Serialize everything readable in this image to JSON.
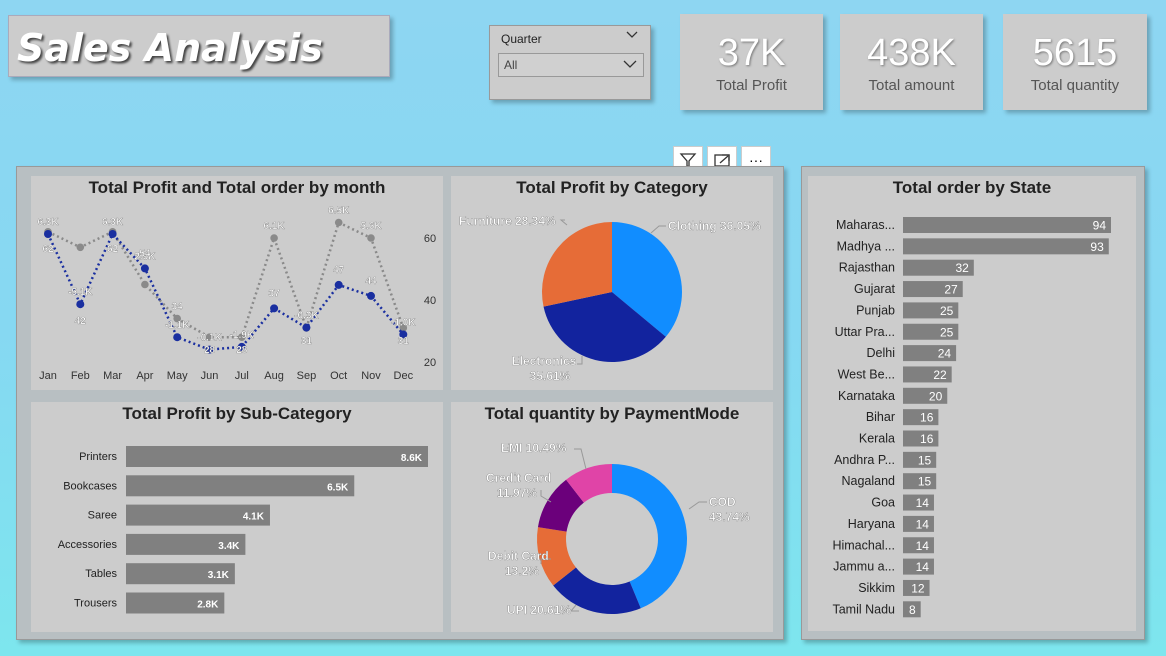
{
  "title": "Sales Analysis",
  "slicer": {
    "label": "Quarter",
    "value": "All"
  },
  "kpis": {
    "profit": {
      "value": "37K",
      "label": "Total Profit"
    },
    "amount": {
      "value": "438K",
      "label": "Total amount"
    },
    "quantity": {
      "value": "5615",
      "label": "Total quantity"
    }
  },
  "toolbar": {
    "more_label": "···"
  },
  "colors": {
    "profit": "#1a2fa0",
    "orders": "#8a8a8a",
    "bar": "#808080",
    "accent_blue": "#118dff",
    "dark_blue": "#12239e",
    "orange": "#e66c37",
    "purple": "#6b007b",
    "pink": "#e044a7"
  },
  "chart_data": [
    {
      "type": "line",
      "title": "Total Profit and Total order by month",
      "categories": [
        "Jan",
        "Feb",
        "Mar",
        "Apr",
        "May",
        "Jun",
        "Jul",
        "Aug",
        "Sep",
        "Oct",
        "Nov",
        "Dec"
      ],
      "series": [
        {
          "axis": "left",
          "values": [
            6300,
            1200,
            6300,
            3800,
            -1200,
            -2100,
            -1900,
            900,
            -500,
            2600,
            1800,
            -1000
          ],
          "labels": [
            "6.3K",
            "-5.1K",
            "6.3K",
            "2.9K",
            "-1.1K",
            "-0.1K",
            "-1.9K",
            "",
            "-0.3K",
            "",
            "",
            "-1.0K"
          ]
        },
        {
          "axis": "right",
          "values": [
            62,
            57,
            62,
            45,
            34,
            28,
            28,
            60,
            31,
            65,
            60,
            31
          ],
          "labels": [
            "62",
            "42",
            "62",
            "54",
            "34",
            "28",
            "28",
            "37",
            "31",
            "47",
            "44",
            "31"
          ]
        }
      ],
      "top_labels": [
        "",
        "",
        "",
        "",
        "",
        "",
        "",
        "6.1K",
        "",
        "6.5K",
        "5.6K",
        ""
      ],
      "right_ticks": [
        "60",
        "40",
        "20"
      ]
    },
    {
      "type": "pie",
      "title": "Total Profit by Category",
      "slices": [
        {
          "label": "Clothing 36.05%",
          "value": 36.05
        },
        {
          "label": "Electronics 35.61%",
          "value": 35.61
        },
        {
          "label": "Furniture 28.34%",
          "value": 28.34
        }
      ]
    },
    {
      "type": "bar",
      "title": "Total Profit by Sub-Category",
      "categories": [
        "Printers",
        "Bookcases",
        "Saree",
        "Accessories",
        "Tables",
        "Trousers"
      ],
      "values": [
        8.6,
        6.5,
        4.1,
        3.4,
        3.1,
        2.8
      ],
      "labels": [
        "8.6K",
        "6.5K",
        "4.1K",
        "3.4K",
        "3.1K",
        "2.8K"
      ]
    },
    {
      "type": "pie",
      "title": "Total quantity by PaymentMode",
      "slices": [
        {
          "label": "COD 43.74%",
          "value": 43.74
        },
        {
          "label": "UPI 20.61%",
          "value": 20.61
        },
        {
          "label": "Debit Card 13.2%",
          "value": 13.2
        },
        {
          "label": "Credit Card 11.97%",
          "value": 11.97
        },
        {
          "label": "EMI 10.49%",
          "value": 10.49
        }
      ]
    },
    {
      "type": "bar",
      "title": "Total order by State",
      "categories": [
        "Maharas...",
        "Madhya ...",
        "Rajasthan",
        "Gujarat",
        "Punjab",
        "Uttar Pra...",
        "Delhi",
        "West Be...",
        "Karnataka",
        "Bihar",
        "Kerala",
        "Andhra P...",
        "Nagaland",
        "Goa",
        "Haryana",
        "Himachal...",
        "Jammu a...",
        "Sikkim",
        "Tamil Nadu"
      ],
      "values": [
        94,
        93,
        32,
        27,
        25,
        25,
        24,
        22,
        20,
        16,
        16,
        15,
        15,
        14,
        14,
        14,
        14,
        12,
        8
      ]
    }
  ]
}
